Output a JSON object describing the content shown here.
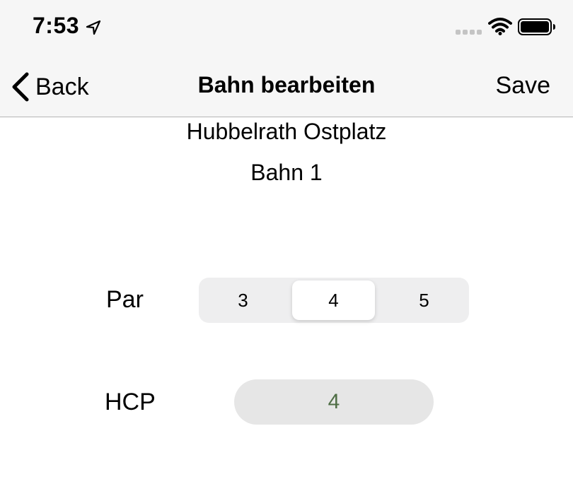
{
  "status_bar": {
    "time": "7:53",
    "icons": [
      "location-arrow-icon",
      "signal-dots-icon",
      "wifi-icon",
      "battery-icon"
    ]
  },
  "nav_bar": {
    "back_label": "Back",
    "title": "Bahn bearbeiten",
    "save_label": "Save"
  },
  "main": {
    "course_name": "Hubbelrath Ostplatz",
    "hole_name": "Bahn 1",
    "par": {
      "label": "Par",
      "options": [
        "3",
        "4",
        "5"
      ],
      "selected_index": 1
    },
    "hcp": {
      "label": "HCP",
      "value": "4"
    }
  },
  "colors": {
    "bar_background": "#f6f6f6",
    "hcp_value": "#4f6e45",
    "segment_track": "#eeeeef",
    "field_background": "#e6e6e6"
  }
}
